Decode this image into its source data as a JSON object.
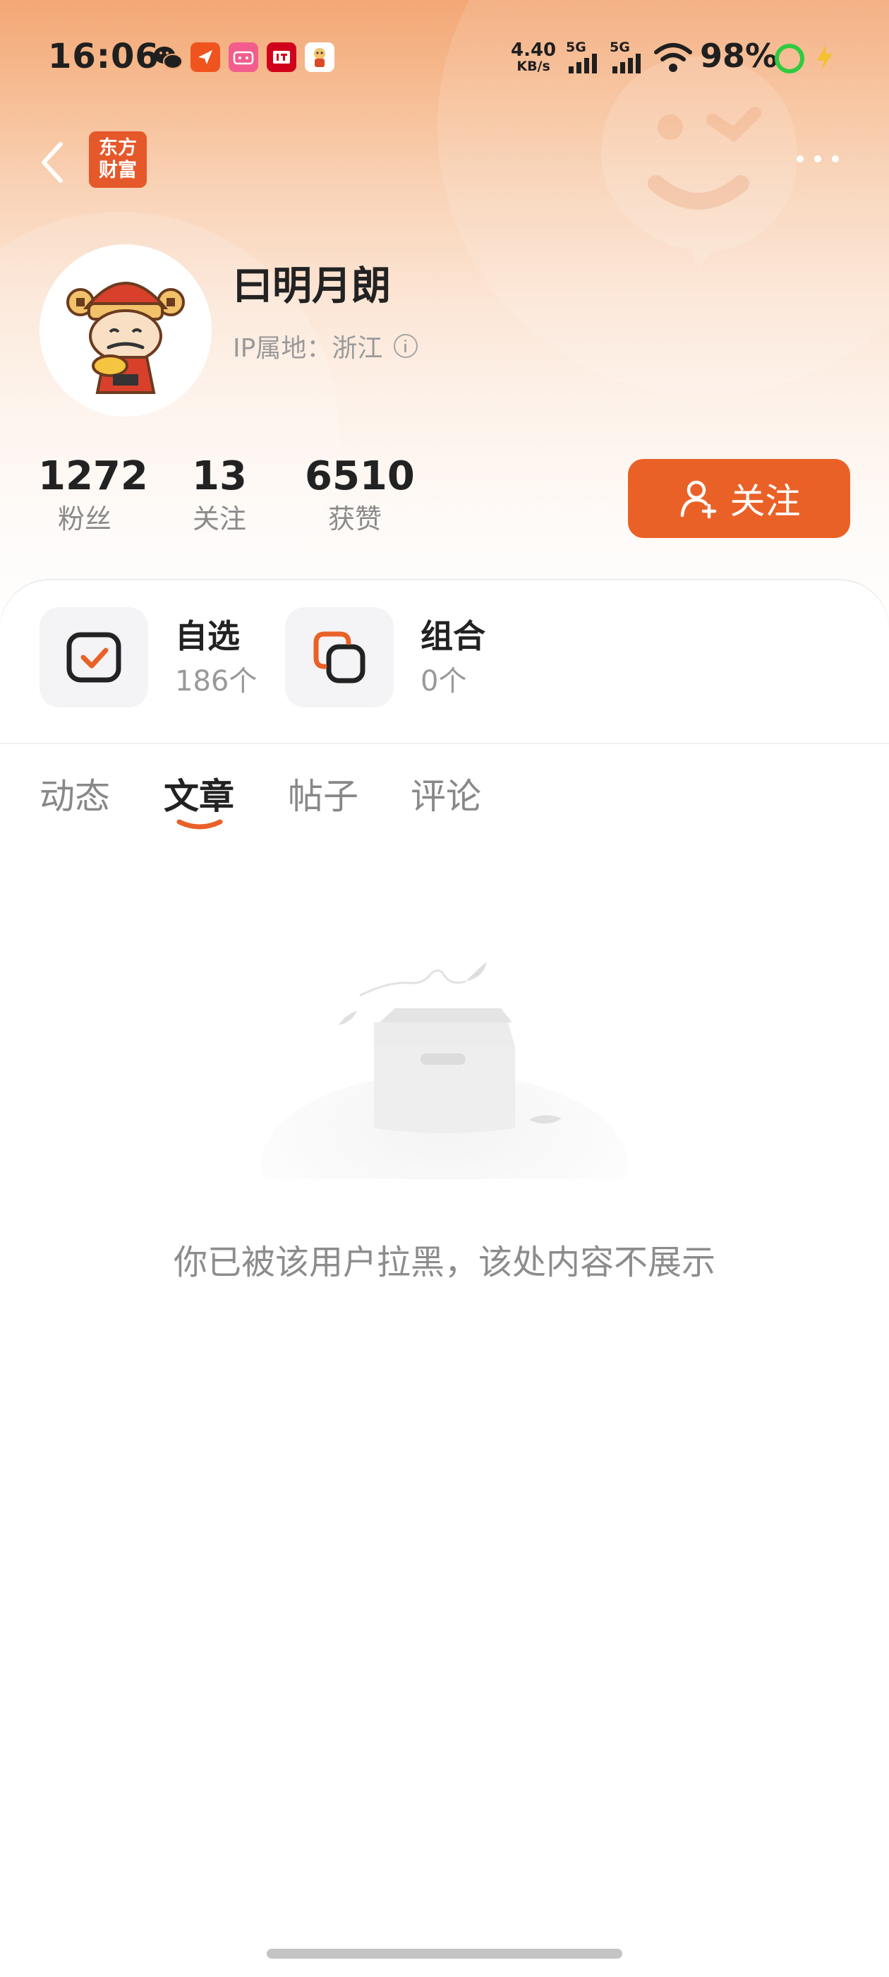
{
  "status_bar": {
    "time": "16:06",
    "net_speed_value": "4.40",
    "net_speed_unit": "KB/s",
    "signal1_label": "5G",
    "signal2_label": "5G",
    "battery": "98%",
    "app_icons": [
      "wechat-icon",
      "app-icon",
      "bilibili-icon",
      "ithome-icon",
      "game-icon"
    ]
  },
  "header": {
    "logo_line1": "东方",
    "logo_line2": "财富",
    "more_label": "…"
  },
  "profile": {
    "username": "曰明月朗",
    "ip_location": "IP属地：浙江"
  },
  "stats": [
    {
      "value": "1272",
      "label": "粉丝"
    },
    {
      "value": "13",
      "label": "关注"
    },
    {
      "value": "6510",
      "label": "获赞"
    }
  ],
  "follow_button": {
    "label": "关注"
  },
  "assets": [
    {
      "title": "自选",
      "count": "186个"
    },
    {
      "title": "组合",
      "count": "0个"
    }
  ],
  "tabs": [
    {
      "label": "动态",
      "active": false
    },
    {
      "label": "文章",
      "active": true
    },
    {
      "label": "帖子",
      "active": false
    },
    {
      "label": "评论",
      "active": false
    }
  ],
  "empty_state": {
    "message": "你已被该用户拉黑，该处内容不展示"
  },
  "colors": {
    "accent": "#ea6128",
    "brand_logo": "#e5582a",
    "text_primary": "#222222",
    "text_secondary": "#8a8a8a"
  }
}
